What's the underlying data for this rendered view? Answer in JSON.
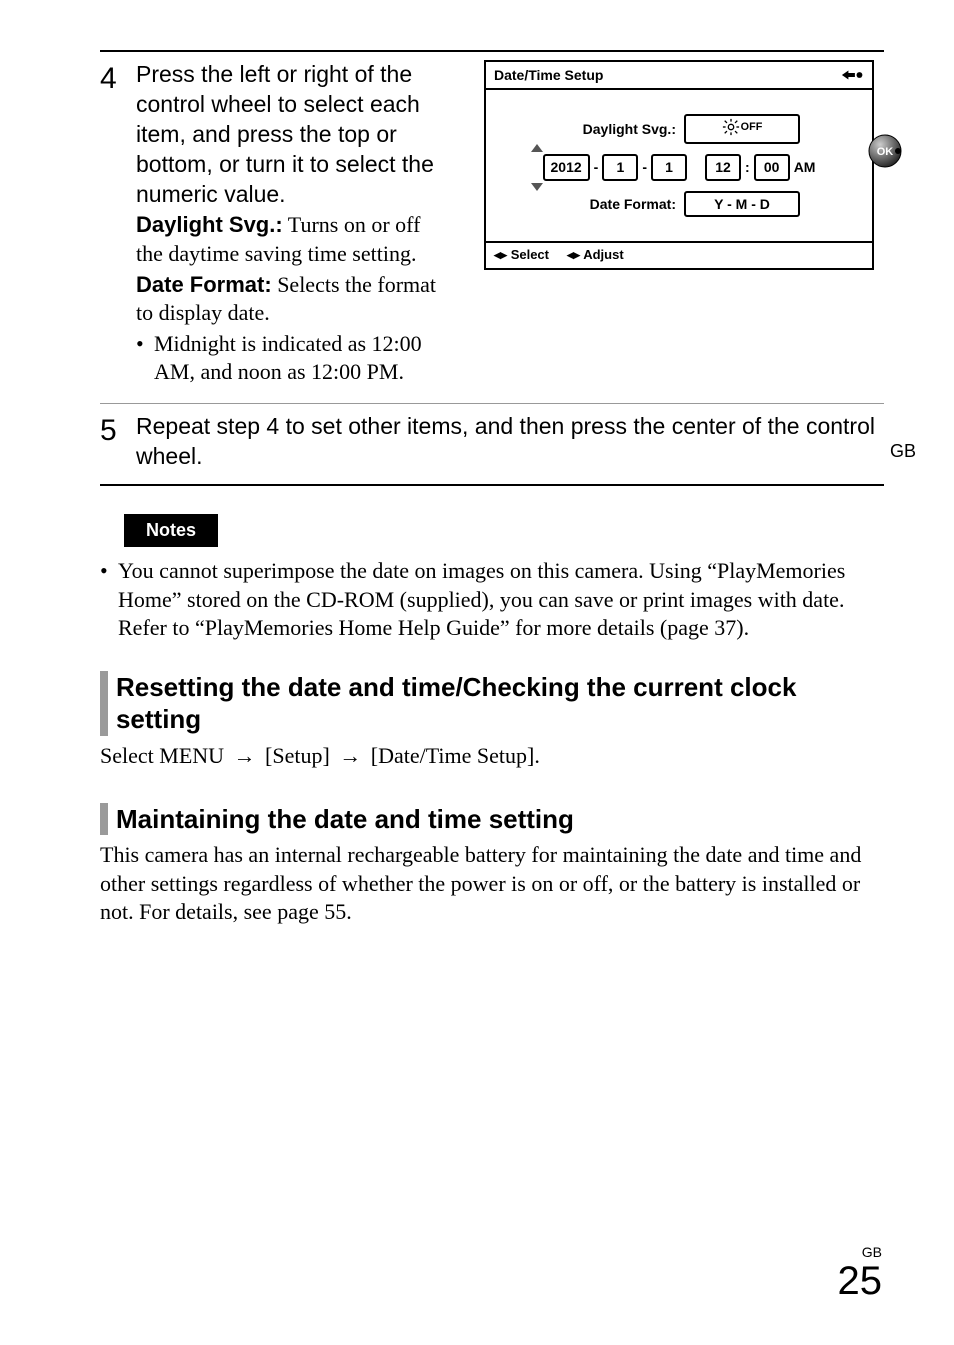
{
  "step4": {
    "num": "4",
    "instruction": "Press the left or right of the control wheel to select each item, and press the top or bottom, or turn it to select the numeric value.",
    "daylight_label": "Daylight Svg.:",
    "daylight_text": " Turns on or off the daytime saving time setting.",
    "dateformat_label": "Date Format:",
    "dateformat_text": " Selects the format to display date.",
    "bullet": "Midnight is indicated as 12:00 AM, and noon as 12:00 PM."
  },
  "shot": {
    "title": "Date/Time Setup",
    "dst_label": "Daylight Svg.:",
    "dst_value": "OFF",
    "date": {
      "y": "2012",
      "m": "1",
      "d": "1"
    },
    "time": {
      "h": "12",
      "min": "00",
      "ampm": "AM"
    },
    "fmt_label": "Date Format:",
    "fmt_value": "Y - M - D",
    "foot_select": "Select",
    "foot_adjust": "Adjust",
    "ok": "OK"
  },
  "step5": {
    "num": "5",
    "instruction": "Repeat step 4 to set other items, and then press the center of the control wheel."
  },
  "side_gb": "GB",
  "notes": {
    "heading": "Notes",
    "item": "You cannot superimpose the date on images on this camera. Using “PlayMemories Home” stored on the CD-ROM (supplied), you can save or print images with date. Refer to “PlayMemories Home Help Guide” for more details (page 37)."
  },
  "h_reset": "Resetting the date and time/Checking the current clock setting",
  "reset_para_pre": "Select MENU ",
  "reset_para_mid1": " [Setup] ",
  "reset_para_mid2": " [Date/Time Setup].",
  "arrow": "→",
  "h_maintain": "Maintaining the date and time setting",
  "maintain_para": "This camera has an internal rechargeable battery for maintaining the date and time and other settings regardless of whether the power is on or off, or the battery is installed or not. For details, see page 55.",
  "footer": {
    "gb": "GB",
    "page": "25"
  }
}
